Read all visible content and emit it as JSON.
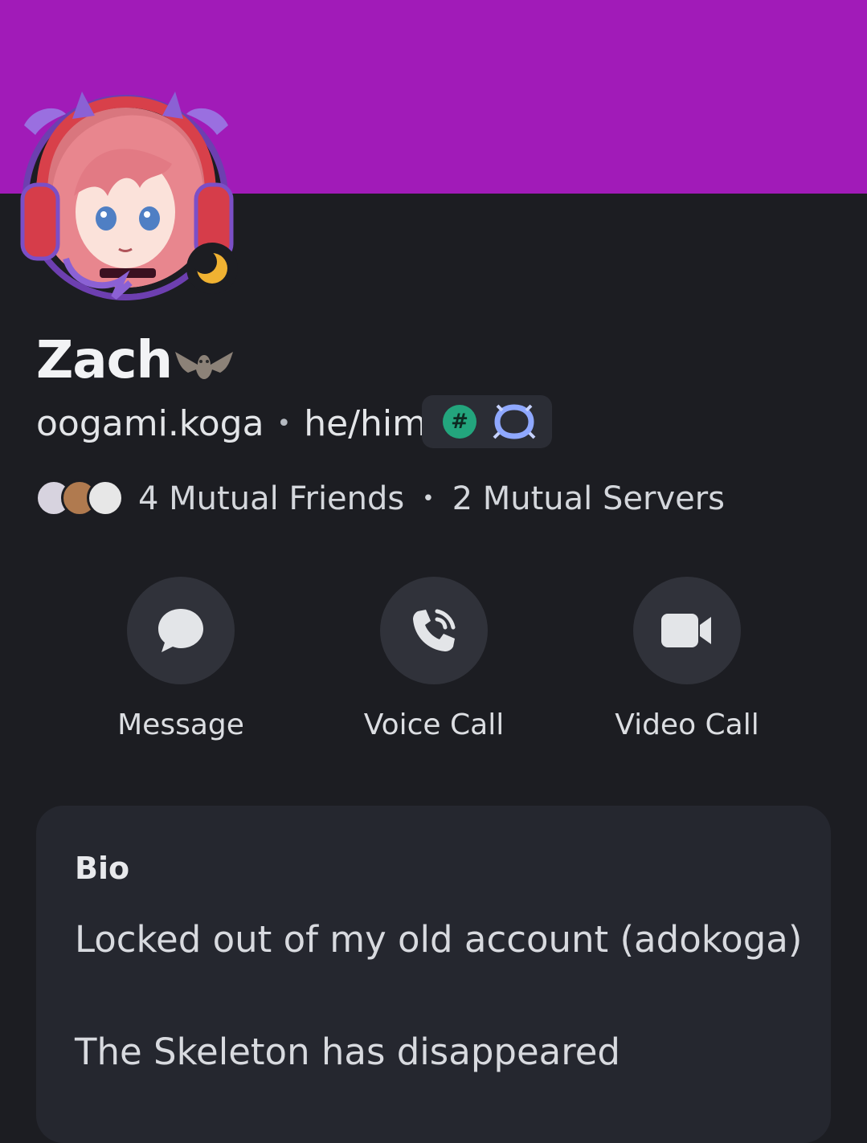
{
  "colors": {
    "banner": "#a11bb8",
    "background": "#1c1d22",
    "card": "#25272f",
    "status_idle": "#f0b232",
    "badge_green": "#23a57d"
  },
  "profile": {
    "display_name": "Zach",
    "name_emoji": "bat-emoji",
    "username": "oogami.koga",
    "separator": "•",
    "pronouns": "he/him",
    "status": "idle",
    "badges": [
      {
        "icon": "hashtag-icon",
        "label": "#"
      },
      {
        "icon": "laurel-badge-icon"
      }
    ]
  },
  "mutuals": {
    "friends": "4 Mutual Friends",
    "separator": "•",
    "servers": "2 Mutual Servers"
  },
  "actions": [
    {
      "label": "Message",
      "icon": "chat-bubble-icon"
    },
    {
      "label": "Voice Call",
      "icon": "phone-icon"
    },
    {
      "label": "Video Call",
      "icon": "video-camera-icon"
    }
  ],
  "bio": {
    "title": "Bio",
    "lines": [
      "Locked out of my old account (adokoga)",
      "The Skeleton has disappeared"
    ]
  }
}
